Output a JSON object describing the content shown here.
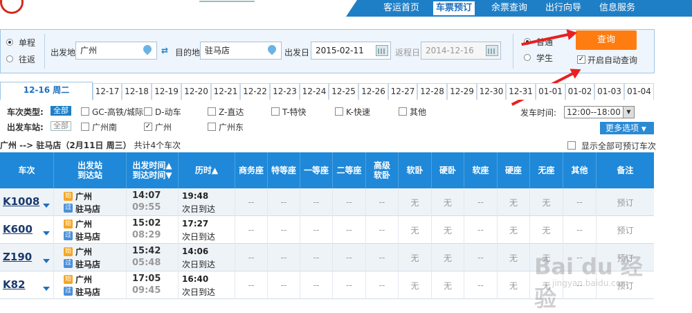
{
  "nav": {
    "items": [
      "客运首页",
      "车票预订",
      "余票查询",
      "出行向导",
      "信息服务"
    ],
    "active": 1
  },
  "search": {
    "trip_types": [
      "单程",
      "往返"
    ],
    "trip_selected": 0,
    "from_label": "出发地",
    "from_value": "广州",
    "to_label": "目的地",
    "to_value": "驻马店",
    "depart_label": "出发日",
    "depart_value": "2015-02-11",
    "return_label": "返程日",
    "return_value": "2014-12-16",
    "passenger_types": [
      "普通",
      "学生"
    ],
    "passenger_selected": 0,
    "query_button": "查询",
    "auto_query_label": "开启自动查询",
    "auto_query_checked": true
  },
  "dates": [
    "12-16 周二",
    "12-17",
    "12-18",
    "12-19",
    "12-20",
    "12-21",
    "12-22",
    "12-23",
    "12-24",
    "12-25",
    "12-26",
    "12-27",
    "12-28",
    "12-29",
    "12-30",
    "12-31",
    "01-01",
    "01-02",
    "01-03",
    "01-04"
  ],
  "filters": {
    "type_label": "车次类型:",
    "all_label": "全部",
    "types": [
      "GC-高铁/城际",
      "D-动车",
      "Z-直达",
      "T-特快",
      "K-快速",
      "其他"
    ],
    "station_label": "出发车站:",
    "stations": [
      "广州南",
      "广州",
      "广州东"
    ],
    "stations_checked": [
      false,
      true,
      false
    ],
    "time_label": "发车时间:",
    "time_value": "12:00--18:00",
    "more_label": "更多选项"
  },
  "summary": {
    "route": "广州 --> 驻马店（2月11日  周三）",
    "count": "共计4个车次",
    "show_all": "显示全部可预订车次"
  },
  "table": {
    "headers": [
      "车次",
      "出发站\n到达站",
      "出发时间▲\n到达时间▼",
      "历时▲",
      "商务座",
      "特等座",
      "一等座",
      "二等座",
      "高级\n软卧",
      "软卧",
      "硬卧",
      "软座",
      "硬座",
      "无座",
      "其他",
      "备注"
    ],
    "start_badge": "始",
    "pass_badge": "过",
    "rows": [
      {
        "train": "K1008",
        "from": "广州",
        "to": "驻马店",
        "dep": "14:07",
        "arr": "09:55",
        "dur": "19:48",
        "note": "次日到达",
        "seats": [
          "--",
          "--",
          "--",
          "--",
          "--",
          "无",
          "无",
          "--",
          "无",
          "无",
          "--"
        ],
        "action": "预订"
      },
      {
        "train": "K600",
        "from": "广州",
        "to": "驻马店",
        "dep": "15:02",
        "arr": "08:29",
        "dur": "17:27",
        "note": "次日到达",
        "seats": [
          "--",
          "--",
          "--",
          "--",
          "--",
          "无",
          "无",
          "--",
          "无",
          "无",
          "--"
        ],
        "action": "预订"
      },
      {
        "train": "Z190",
        "from": "广州",
        "to": "驻马店",
        "dep": "15:42",
        "arr": "05:48",
        "dur": "14:06",
        "note": "次日到达",
        "seats": [
          "--",
          "--",
          "--",
          "--",
          "--",
          "无",
          "无",
          "--",
          "无",
          "无",
          "--"
        ],
        "action": "预订"
      },
      {
        "train": "K82",
        "from": "广州",
        "to": "驻马店",
        "dep": "17:05",
        "arr": "09:45",
        "dur": "16:40",
        "note": "次日到达",
        "seats": [
          "--",
          "--",
          "--",
          "--",
          "--",
          "无",
          "无",
          "--",
          "无",
          "无",
          "--"
        ],
        "action": "预订"
      }
    ]
  },
  "watermark": {
    "main": "Bai du 经验",
    "sub": "jingyan.baidu.com"
  }
}
